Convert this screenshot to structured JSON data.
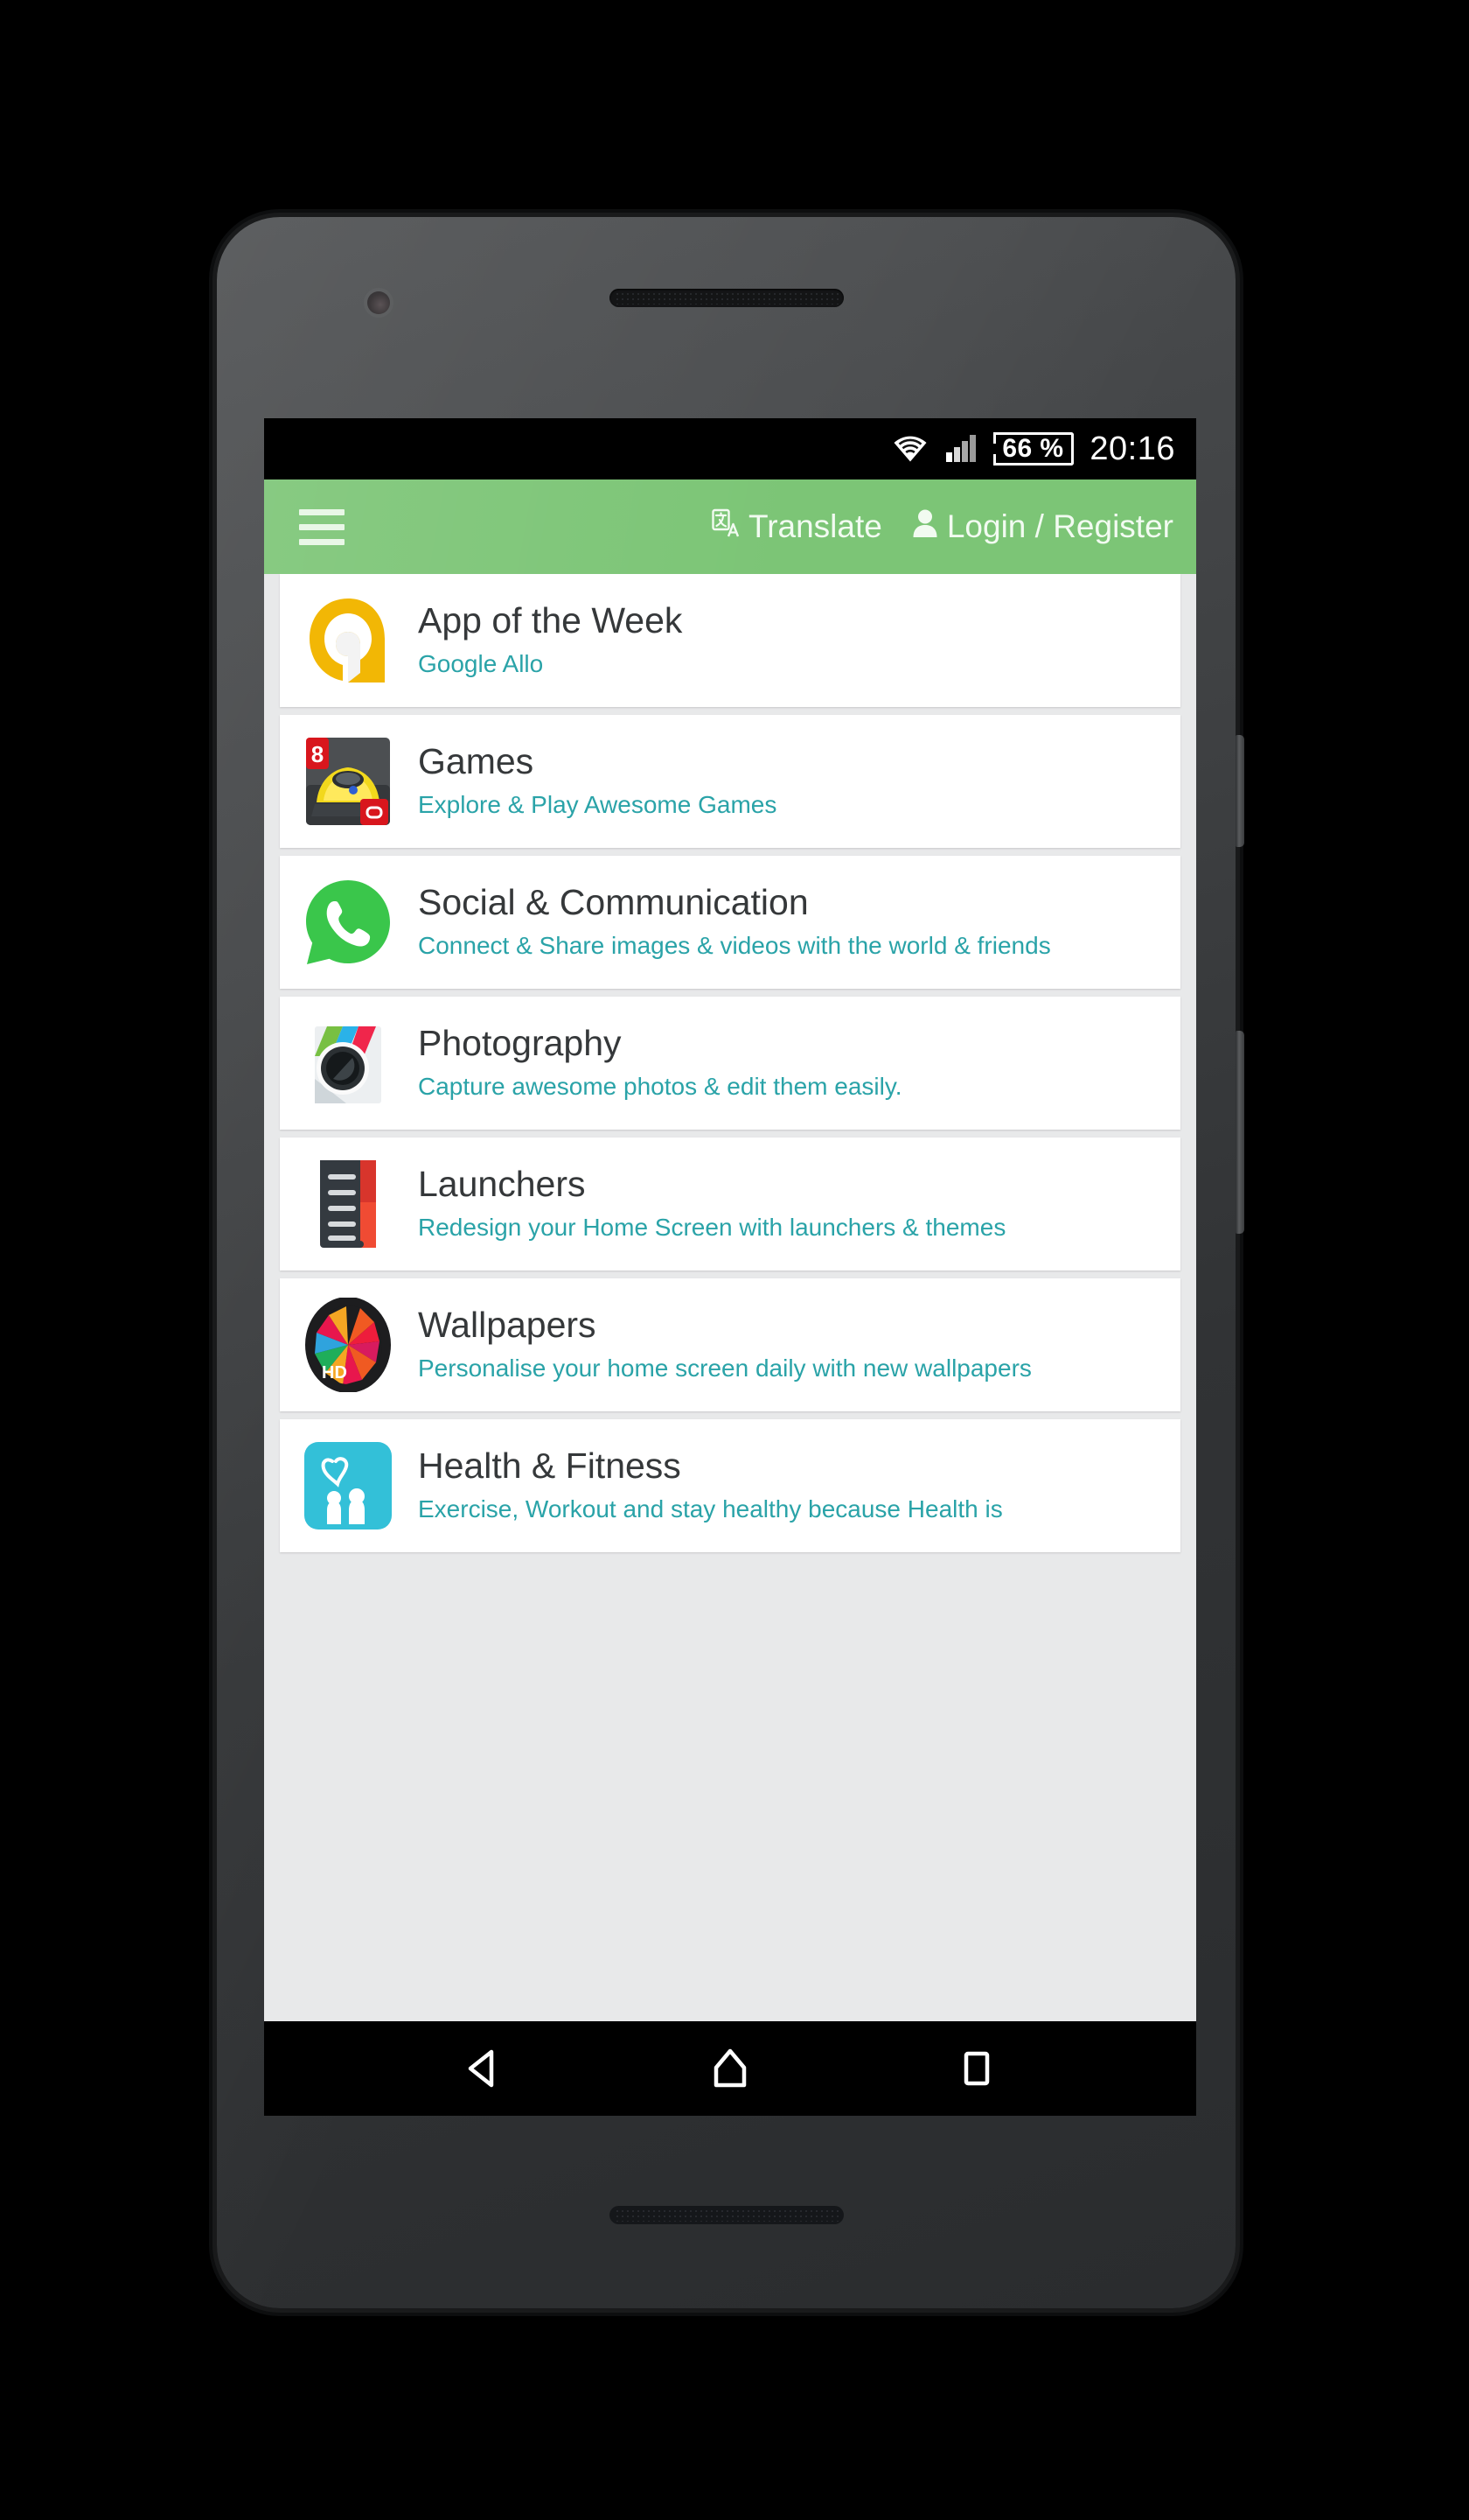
{
  "status_bar": {
    "wifi_icon": "wifi-icon",
    "signal_icon": "cellular-signal-icon",
    "battery_icon": "battery-icon",
    "battery_text": "66 %",
    "time": "20:16"
  },
  "app_bar": {
    "menu_icon": "hamburger-menu-icon",
    "translate_icon": "translate-icon",
    "translate_label": "Translate",
    "account_icon": "person-icon",
    "login_label": "Login / Register",
    "background_color": "#7cc576"
  },
  "list": {
    "items": [
      {
        "icon": "google-allo-icon",
        "title": "App of the Week",
        "subtitle": "Google Allo"
      },
      {
        "icon": "asphalt8-racing-game-icon",
        "title": "Games",
        "subtitle": "Explore & Play Awesome Games"
      },
      {
        "icon": "whatsapp-icon",
        "title": "Social & Communication",
        "subtitle": "Connect & Share images & videos with the world & friends"
      },
      {
        "icon": "camera-photo-editor-icon",
        "title": "Photography",
        "subtitle": "Capture awesome photos & edit them easily."
      },
      {
        "icon": "launcher-app-icon",
        "title": "Launchers",
        "subtitle": "Redesign your Home Screen with launchers & themes"
      },
      {
        "icon": "wallpapers-hd-icon",
        "title": "Wallpapers",
        "subtitle": "Personalise your home screen daily with new wallpapers"
      },
      {
        "icon": "health-fitness-icon",
        "title": "Health & Fitness",
        "subtitle": "Exercise, Workout and stay healthy because Health is"
      }
    ],
    "title_color": "#35383a",
    "subtitle_color": "#2aa3a8",
    "background_color": "#e8e9ea"
  },
  "nav_bar": {
    "back_icon": "back-triangle-icon",
    "home_icon": "home-pentagon-icon",
    "recents_icon": "recents-square-icon"
  }
}
